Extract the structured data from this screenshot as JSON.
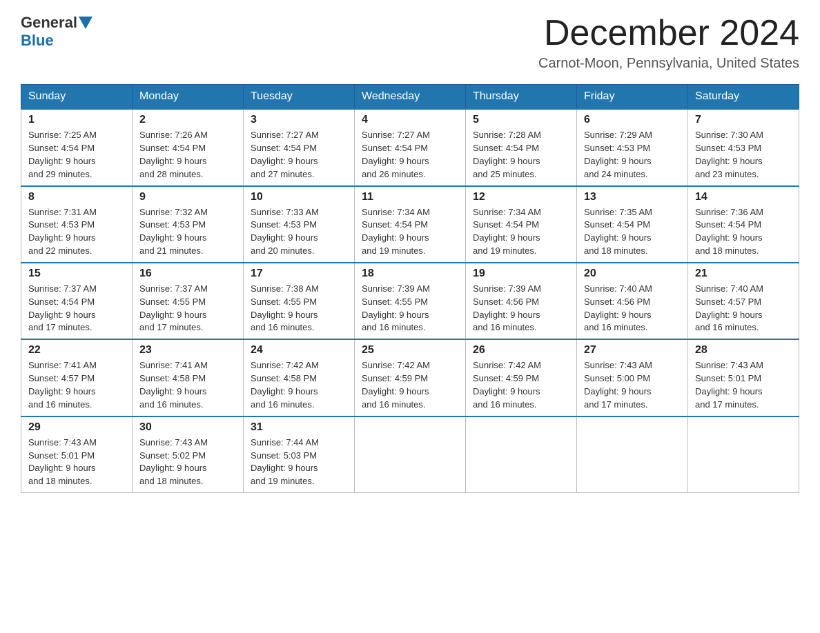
{
  "logo": {
    "general": "General",
    "blue": "Blue"
  },
  "header": {
    "title": "December 2024",
    "subtitle": "Carnot-Moon, Pennsylvania, United States"
  },
  "calendar": {
    "days_of_week": [
      "Sunday",
      "Monday",
      "Tuesday",
      "Wednesday",
      "Thursday",
      "Friday",
      "Saturday"
    ],
    "weeks": [
      [
        {
          "day": "1",
          "sunrise": "7:25 AM",
          "sunset": "4:54 PM",
          "daylight": "9 hours and 29 minutes."
        },
        {
          "day": "2",
          "sunrise": "7:26 AM",
          "sunset": "4:54 PM",
          "daylight": "9 hours and 28 minutes."
        },
        {
          "day": "3",
          "sunrise": "7:27 AM",
          "sunset": "4:54 PM",
          "daylight": "9 hours and 27 minutes."
        },
        {
          "day": "4",
          "sunrise": "7:27 AM",
          "sunset": "4:54 PM",
          "daylight": "9 hours and 26 minutes."
        },
        {
          "day": "5",
          "sunrise": "7:28 AM",
          "sunset": "4:54 PM",
          "daylight": "9 hours and 25 minutes."
        },
        {
          "day": "6",
          "sunrise": "7:29 AM",
          "sunset": "4:53 PM",
          "daylight": "9 hours and 24 minutes."
        },
        {
          "day": "7",
          "sunrise": "7:30 AM",
          "sunset": "4:53 PM",
          "daylight": "9 hours and 23 minutes."
        }
      ],
      [
        {
          "day": "8",
          "sunrise": "7:31 AM",
          "sunset": "4:53 PM",
          "daylight": "9 hours and 22 minutes."
        },
        {
          "day": "9",
          "sunrise": "7:32 AM",
          "sunset": "4:53 PM",
          "daylight": "9 hours and 21 minutes."
        },
        {
          "day": "10",
          "sunrise": "7:33 AM",
          "sunset": "4:53 PM",
          "daylight": "9 hours and 20 minutes."
        },
        {
          "day": "11",
          "sunrise": "7:34 AM",
          "sunset": "4:54 PM",
          "daylight": "9 hours and 19 minutes."
        },
        {
          "day": "12",
          "sunrise": "7:34 AM",
          "sunset": "4:54 PM",
          "daylight": "9 hours and 19 minutes."
        },
        {
          "day": "13",
          "sunrise": "7:35 AM",
          "sunset": "4:54 PM",
          "daylight": "9 hours and 18 minutes."
        },
        {
          "day": "14",
          "sunrise": "7:36 AM",
          "sunset": "4:54 PM",
          "daylight": "9 hours and 18 minutes."
        }
      ],
      [
        {
          "day": "15",
          "sunrise": "7:37 AM",
          "sunset": "4:54 PM",
          "daylight": "9 hours and 17 minutes."
        },
        {
          "day": "16",
          "sunrise": "7:37 AM",
          "sunset": "4:55 PM",
          "daylight": "9 hours and 17 minutes."
        },
        {
          "day": "17",
          "sunrise": "7:38 AM",
          "sunset": "4:55 PM",
          "daylight": "9 hours and 16 minutes."
        },
        {
          "day": "18",
          "sunrise": "7:39 AM",
          "sunset": "4:55 PM",
          "daylight": "9 hours and 16 minutes."
        },
        {
          "day": "19",
          "sunrise": "7:39 AM",
          "sunset": "4:56 PM",
          "daylight": "9 hours and 16 minutes."
        },
        {
          "day": "20",
          "sunrise": "7:40 AM",
          "sunset": "4:56 PM",
          "daylight": "9 hours and 16 minutes."
        },
        {
          "day": "21",
          "sunrise": "7:40 AM",
          "sunset": "4:57 PM",
          "daylight": "9 hours and 16 minutes."
        }
      ],
      [
        {
          "day": "22",
          "sunrise": "7:41 AM",
          "sunset": "4:57 PM",
          "daylight": "9 hours and 16 minutes."
        },
        {
          "day": "23",
          "sunrise": "7:41 AM",
          "sunset": "4:58 PM",
          "daylight": "9 hours and 16 minutes."
        },
        {
          "day": "24",
          "sunrise": "7:42 AM",
          "sunset": "4:58 PM",
          "daylight": "9 hours and 16 minutes."
        },
        {
          "day": "25",
          "sunrise": "7:42 AM",
          "sunset": "4:59 PM",
          "daylight": "9 hours and 16 minutes."
        },
        {
          "day": "26",
          "sunrise": "7:42 AM",
          "sunset": "4:59 PM",
          "daylight": "9 hours and 16 minutes."
        },
        {
          "day": "27",
          "sunrise": "7:43 AM",
          "sunset": "5:00 PM",
          "daylight": "9 hours and 17 minutes."
        },
        {
          "day": "28",
          "sunrise": "7:43 AM",
          "sunset": "5:01 PM",
          "daylight": "9 hours and 17 minutes."
        }
      ],
      [
        {
          "day": "29",
          "sunrise": "7:43 AM",
          "sunset": "5:01 PM",
          "daylight": "9 hours and 18 minutes."
        },
        {
          "day": "30",
          "sunrise": "7:43 AM",
          "sunset": "5:02 PM",
          "daylight": "9 hours and 18 minutes."
        },
        {
          "day": "31",
          "sunrise": "7:44 AM",
          "sunset": "5:03 PM",
          "daylight": "9 hours and 19 minutes."
        },
        null,
        null,
        null,
        null
      ]
    ],
    "labels": {
      "sunrise": "Sunrise: ",
      "sunset": "Sunset: ",
      "daylight": "Daylight: "
    }
  }
}
